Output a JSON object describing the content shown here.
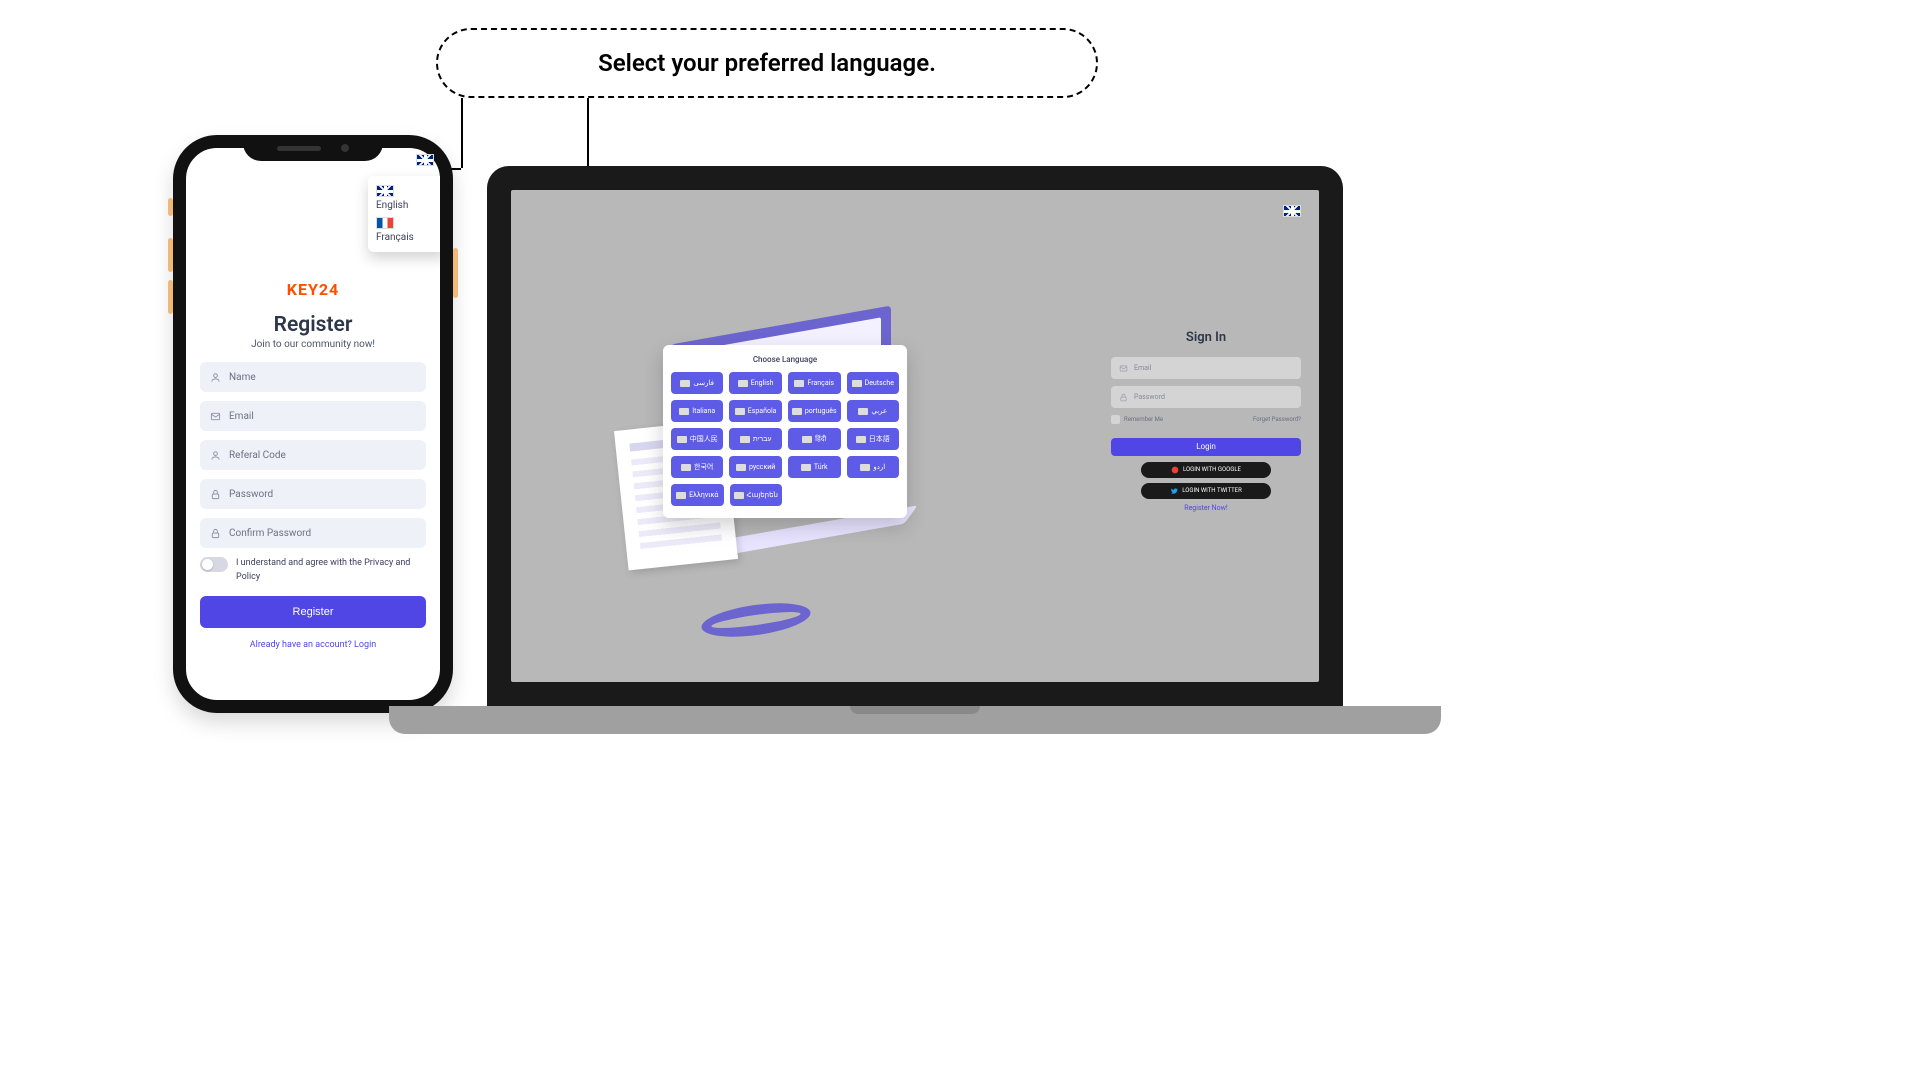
{
  "speech_bubble": "Select your preferred language.",
  "phone": {
    "lang_popover": [
      {
        "label": "English",
        "flag": "uk"
      },
      {
        "label": "Français",
        "flag": "fr"
      }
    ],
    "logo": "KEY24",
    "register": {
      "title": "Register",
      "subtitle": "Join to our community now!",
      "fields": {
        "name": "Name",
        "email": "Email",
        "referal": "Referal Code",
        "password": "Password",
        "confirm": "Confirm Password"
      },
      "agree": "I understand and agree with the Privacy and Policy",
      "button": "Register",
      "already": "Already have an account? Login"
    }
  },
  "laptop": {
    "modal_title": "Choose Language",
    "languages": [
      "فارسی",
      "English",
      "Français",
      "Deutsche",
      "Italiana",
      "Española",
      "português",
      "عربي",
      "中国人民",
      "עברית",
      "हिंदी",
      "日本語",
      "한국어",
      "русский",
      "Türk",
      "اردو",
      "Ελληνικά",
      "Հայերեն"
    ],
    "signin": {
      "title": "Sign In",
      "email": "Email",
      "password": "Password",
      "remember": "Remember Me",
      "forget": "Forget Password?",
      "login": "Login",
      "google": "LOGIN WITH GOOGLE",
      "twitter": "LOGIN WITH TWITTER",
      "register": "Register Now!"
    }
  }
}
